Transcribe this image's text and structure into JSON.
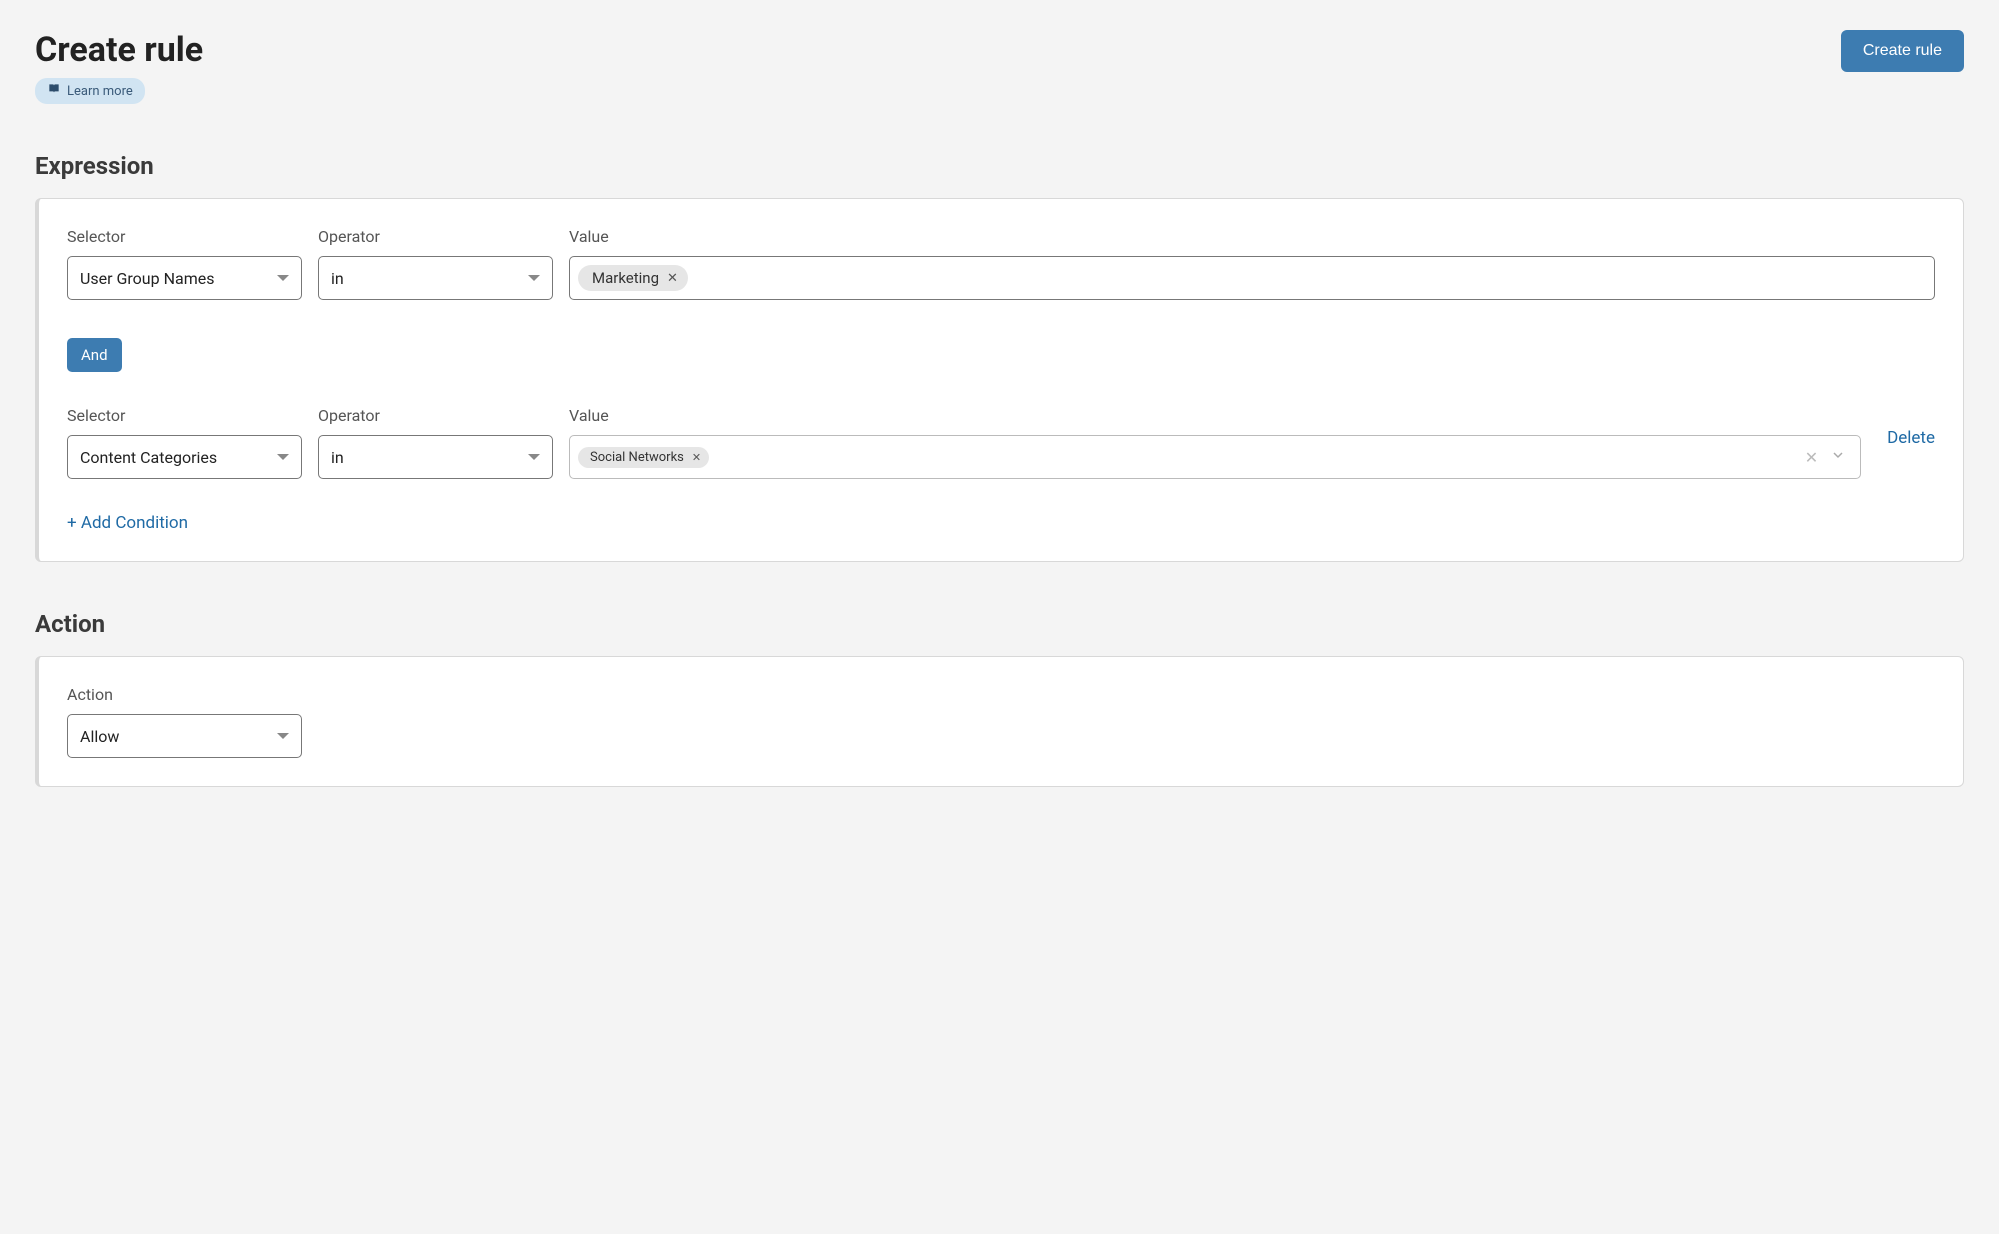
{
  "header": {
    "title": "Create rule",
    "learn_more_label": "Learn more",
    "create_button_label": "Create rule"
  },
  "sections": {
    "expression_title": "Expression",
    "action_title": "Action"
  },
  "labels": {
    "selector": "Selector",
    "operator": "Operator",
    "value": "Value",
    "action": "Action"
  },
  "expression": {
    "conditions": [
      {
        "selector": "User Group Names",
        "operator": "in",
        "tags": [
          "Marketing"
        ]
      },
      {
        "selector": "Content Categories",
        "operator": "in",
        "tags": [
          "Social Networks"
        ]
      }
    ],
    "joiner": "And",
    "add_condition_label": "+ Add Condition",
    "delete_label": "Delete"
  },
  "action": {
    "selected": "Allow"
  }
}
